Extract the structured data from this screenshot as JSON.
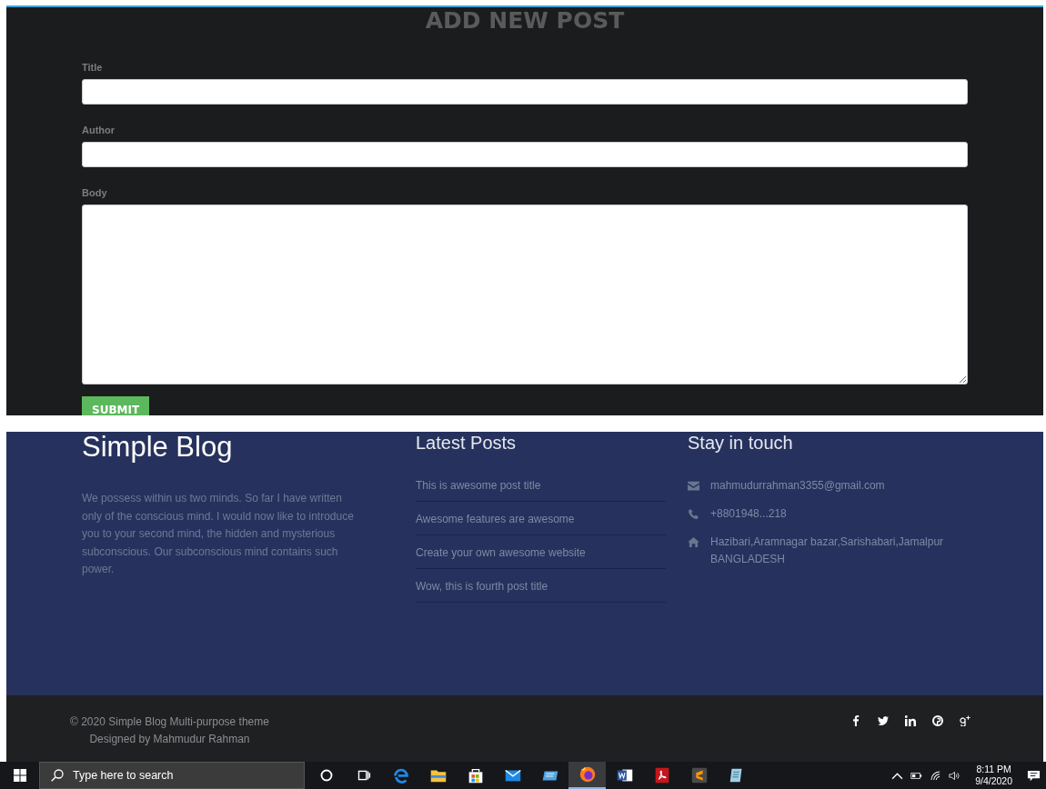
{
  "form": {
    "heading": "ADD NEW POST",
    "fields": [
      {
        "label": "Title",
        "kind": "input"
      },
      {
        "label": "Author",
        "kind": "input"
      },
      {
        "label": "Body",
        "kind": "textarea"
      }
    ],
    "submit": "SUBMIT"
  },
  "footer": {
    "brand": "Simple Blog",
    "about": "We possess within us two minds. So far I have written only of the conscious mind. I would now like to introduce you to your second mind, the hidden and mysterious subconscious. Our subconscious mind contains such power.",
    "latest_title": "Latest Posts",
    "latest_posts": [
      "This is awesome post title",
      "Awesome features are awesome",
      "Create your own awesome website",
      "Wow, this is fourth post title"
    ],
    "contact_title": "Stay in touch",
    "contacts": [
      {
        "kind": "email",
        "text": "mahmudurrahman3355@gmail.com"
      },
      {
        "kind": "phone",
        "text": "+8801948...218"
      },
      {
        "kind": "home",
        "text": "Hazibari,Aramnagar bazar,Sarishabari,Jamalpur BANGLADESH"
      }
    ]
  },
  "bottom_bar": {
    "copyright": "© 2020 Simple Blog Multi-purpose theme",
    "designer": "Designed by Mahmudur Rahman",
    "social": [
      {
        "kind": "facebook"
      },
      {
        "kind": "twitter"
      },
      {
        "kind": "linkedin"
      },
      {
        "kind": "pinterest"
      },
      {
        "kind": "googleplus"
      }
    ]
  },
  "taskbar": {
    "search_placeholder": "Type here to search",
    "apps": [
      {
        "kind": "cortana",
        "selected": false
      },
      {
        "kind": "taskview",
        "selected": false
      },
      {
        "kind": "edge",
        "selected": false
      },
      {
        "kind": "explorer",
        "selected": false
      },
      {
        "kind": "store",
        "selected": false
      },
      {
        "kind": "mail",
        "selected": false
      },
      {
        "kind": "tablet",
        "selected": false
      },
      {
        "kind": "firefox",
        "selected": true
      },
      {
        "kind": "word",
        "selected": false
      },
      {
        "kind": "acrobat",
        "selected": false
      },
      {
        "kind": "sublime",
        "selected": false
      },
      {
        "kind": "notepad",
        "selected": false
      }
    ],
    "time": "8:11 PM",
    "date": "9/4/2020"
  }
}
